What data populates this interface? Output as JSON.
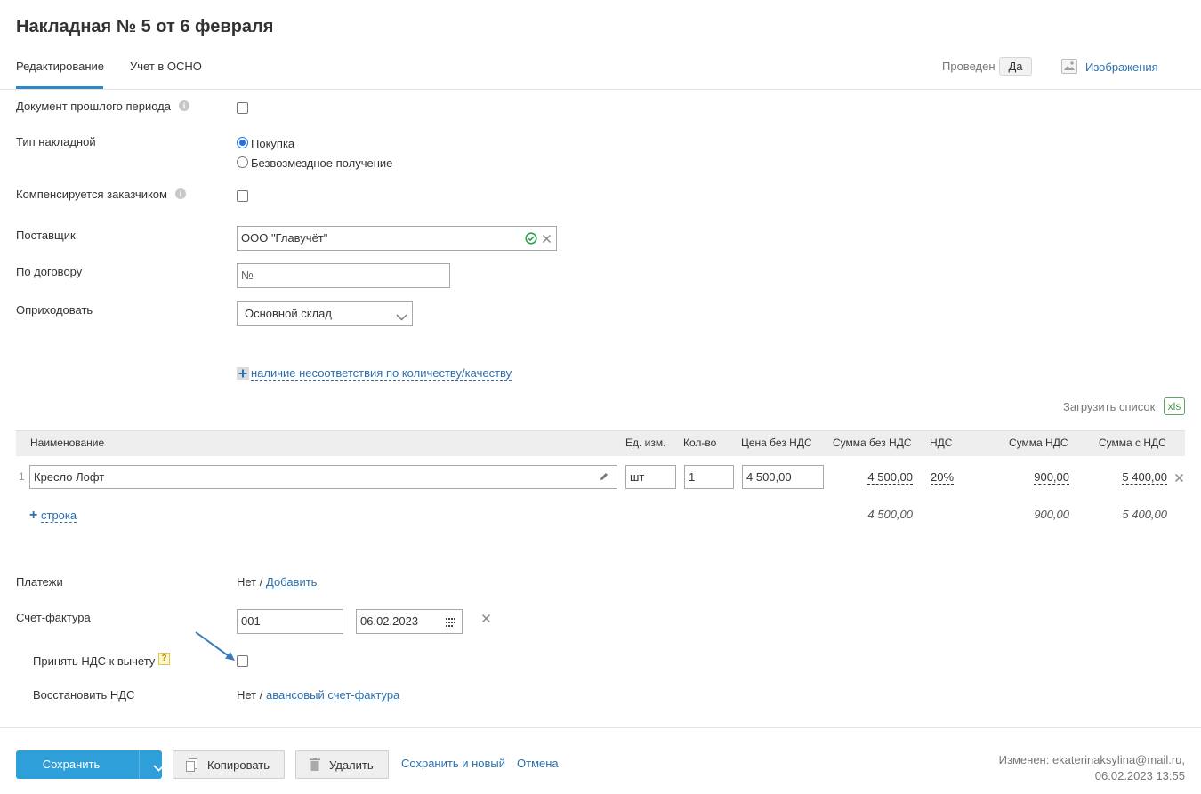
{
  "header": {
    "title": "Накладная № 5 от 6 февраля",
    "tabs": [
      {
        "label": "Редактирование"
      },
      {
        "label": "Учет в ОСНО"
      }
    ],
    "posted_label": "Проведен",
    "posted_value": "Да",
    "images_link": "Изображения"
  },
  "form": {
    "prev_period_label": "Документ прошлого периода",
    "type_label": "Тип накладной",
    "type_options": [
      {
        "label": "Покупка",
        "selected": true
      },
      {
        "label": "Безвозмездное получение",
        "selected": false
      }
    ],
    "compensated_label": "Компенсируется заказчиком",
    "supplier_label": "Поставщик",
    "supplier_value": "ООО \"Главучёт\"",
    "contract_label": "По договору",
    "contract_placeholder": "№",
    "receive_label": "Оприходовать",
    "receive_value": "Основной склад",
    "discrepancy_link": "наличие несоответствия по количеству/качеству"
  },
  "table": {
    "load_list_label": "Загрузить список",
    "xls_label": "xls",
    "columns": [
      "Наименование",
      "Ед. изм.",
      "Кол-во",
      "Цена без НДС",
      "Сумма без НДС",
      "НДС",
      "Сумма НДС",
      "Сумма с НДС"
    ],
    "rows": [
      {
        "num": "1",
        "name": "Кресло Лофт",
        "unit": "шт",
        "qty": "1",
        "price": "4 500,00",
        "sum_no_vat": "4 500,00",
        "vat": "20%",
        "vat_sum": "900,00",
        "sum_with_vat": "5 400,00"
      }
    ],
    "add_row_label": "строка",
    "totals": {
      "sum_no_vat": "4 500,00",
      "vat_sum": "900,00",
      "sum_with_vat": "5 400,00"
    }
  },
  "payments": {
    "label": "Платежи",
    "value": "Нет /",
    "add_link": "Добавить"
  },
  "invoice": {
    "label": "Счет-фактура",
    "number": "001",
    "date": "06.02.2023",
    "vat_deduction_label": "Принять НДС к вычету",
    "help_mark": "?",
    "restore_vat_label": "Восстановить НДС",
    "restore_value": "Нет /",
    "advance_link": "авансовый счет-фактура"
  },
  "footer": {
    "save": "Сохранить",
    "copy": "Копировать",
    "delete": "Удалить",
    "save_new": "Сохранить и новый",
    "cancel": "Отмена",
    "changed_line1": "Изменен: ekaterinaksylina@mail.ru,",
    "changed_line2": "06.02.2023 13:55"
  },
  "colors": {
    "accent": "#2e87c8",
    "link": "#2c6fad",
    "primary_button": "#2e9fd8",
    "check_green": "#2ea44f",
    "arrow": "#3a7bbf"
  },
  "icons": [
    "info-icon",
    "image-icon",
    "check-circle-icon",
    "clear-icon",
    "chevron-down-icon",
    "plus-icon",
    "pencil-icon",
    "remove-row-icon",
    "calendar-icon",
    "help-icon",
    "arrow-annotation",
    "copy-icon",
    "trash-icon"
  ]
}
